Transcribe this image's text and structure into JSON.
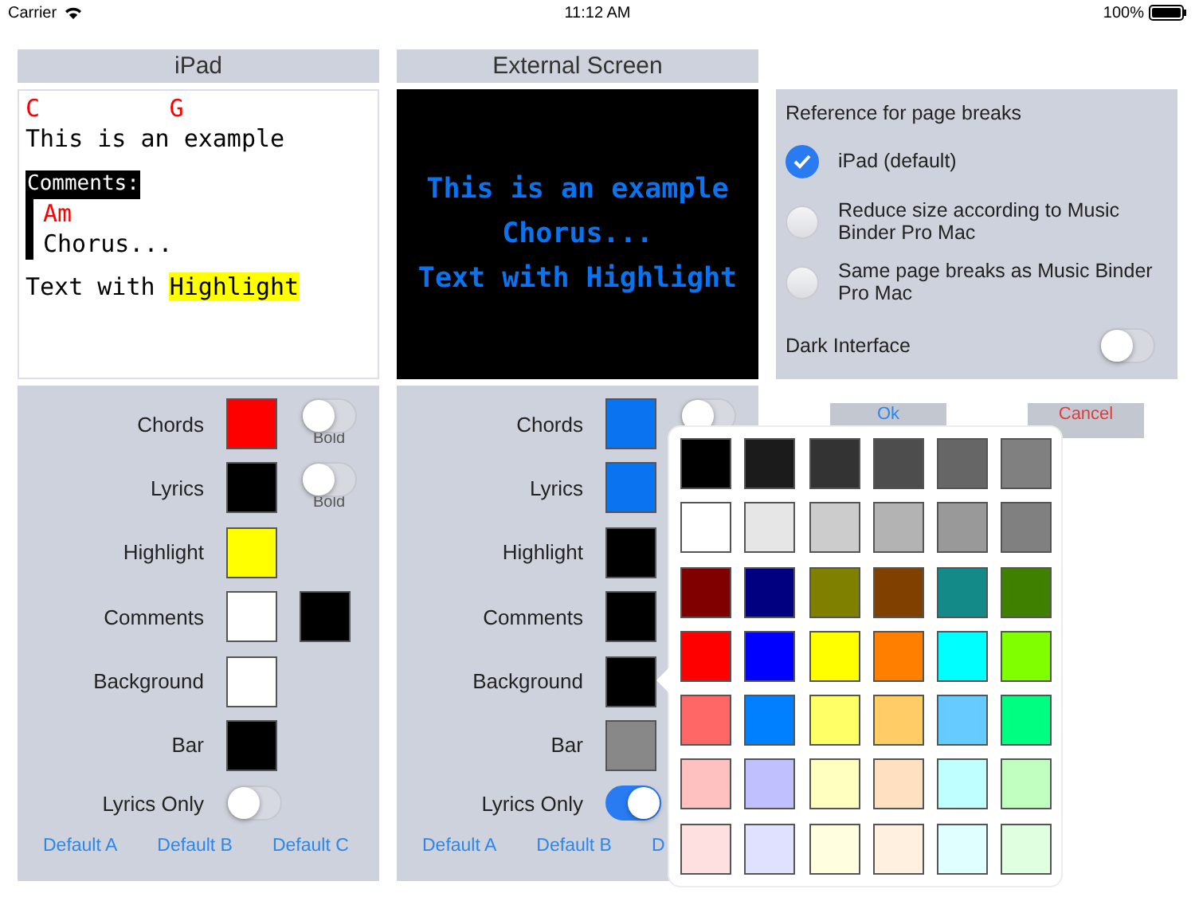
{
  "status_bar": {
    "carrier": "Carrier",
    "time": "11:12 AM",
    "battery": "100%"
  },
  "panels": [
    {
      "title": "iPad",
      "preview": {
        "kind": "full",
        "chords": "C         G",
        "lyrics": "This is an example",
        "comment_label": "Comments:",
        "comment_chords": "Am",
        "comment_lyrics": "Chorus...",
        "text": "Text with ",
        "highlight": "Highlight"
      },
      "rows": [
        {
          "label": "Chords",
          "color": "#ff0000",
          "bold_toggle": {
            "on": false,
            "label": "Bold"
          }
        },
        {
          "label": "Lyrics",
          "color": "#000000",
          "bold_toggle": {
            "on": false,
            "label": "Bold"
          }
        },
        {
          "label": "Highlight",
          "color": "#ffff00"
        },
        {
          "label": "Comments",
          "color": "#ffffff",
          "frame": {
            "color": "#000000"
          }
        },
        {
          "label": "Background",
          "color": "#ffffff"
        },
        {
          "label": "Bar",
          "color": "#000000"
        }
      ],
      "lyrics_only": {
        "label": "Lyrics Only",
        "on": false
      },
      "defaults": [
        "Default A",
        "Default B",
        "Default C"
      ]
    },
    {
      "title": "External Screen",
      "preview": {
        "kind": "lyrics_only",
        "lines": [
          "This is an example",
          "Chorus...",
          "Text with Highlight"
        ]
      },
      "rows": [
        {
          "label": "Chords",
          "color": "#0a74f0",
          "bold_toggle": {
            "on": false
          }
        },
        {
          "label": "Lyrics",
          "color": "#0a74f0"
        },
        {
          "label": "Highlight",
          "color": "#000000"
        },
        {
          "label": "Comments",
          "color": "#000000"
        },
        {
          "label": "Background",
          "color": "#000000"
        },
        {
          "label": "Bar",
          "color": "#888888"
        }
      ],
      "lyrics_only": {
        "label": "Lyrics Only",
        "on": true
      },
      "defaults": [
        "Default A",
        "Default B",
        "D"
      ]
    }
  ],
  "page_breaks": {
    "title": "Reference for page breaks",
    "options": [
      {
        "label": "iPad (default)",
        "selected": true
      },
      {
        "label": "Reduce size according to Music Binder Pro Mac",
        "selected": false
      },
      {
        "label": "Same page breaks as Music Binder Pro Mac",
        "selected": false
      }
    ],
    "dark_interface": {
      "label": "Dark Interface",
      "on": false
    }
  },
  "buttons": {
    "ok": "Ok",
    "cancel": "Cancel"
  },
  "palette": [
    {
      "color": "#000000"
    },
    {
      "color": "#1b1b1b"
    },
    {
      "color": "#333333"
    },
    {
      "color": "#4d4d4d"
    },
    {
      "color": "#666666"
    },
    {
      "color": "#808080"
    },
    {
      "color": "#ffffff"
    },
    {
      "color": "#e6e6e6"
    },
    {
      "color": "#cccccc"
    },
    {
      "color": "#b3b3b3"
    },
    {
      "color": "#999999"
    },
    {
      "color": "#808080"
    },
    {
      "color": "#800000"
    },
    {
      "color": "#000080"
    },
    {
      "color": "#808000"
    },
    {
      "color": "#804000"
    },
    {
      "color": "#138a87"
    },
    {
      "color": "#408000"
    },
    {
      "color": "#ff0000"
    },
    {
      "color": "#0000ff"
    },
    {
      "color": "#ffff00"
    },
    {
      "color": "#ff8000"
    },
    {
      "color": "#00ffff"
    },
    {
      "color": "#80ff00"
    },
    {
      "color": "#ff6666"
    },
    {
      "color": "#0080ff"
    },
    {
      "color": "#ffff66"
    },
    {
      "color": "#ffcc66"
    },
    {
      "color": "#66ccff"
    },
    {
      "color": "#00ff80"
    },
    {
      "color": "#ffc0c0"
    },
    {
      "color": "#c0c0ff"
    },
    {
      "color": "#ffffc0"
    },
    {
      "color": "#ffe0c0"
    },
    {
      "color": "#c0ffff"
    },
    {
      "color": "#c0ffc0"
    },
    {
      "color": "#ffe0e0"
    },
    {
      "color": "#e0e0ff"
    },
    {
      "color": "#ffffe0"
    },
    {
      "color": "#fff0e0"
    },
    {
      "color": "#e0ffff"
    },
    {
      "color": "#e0ffe0"
    }
  ]
}
